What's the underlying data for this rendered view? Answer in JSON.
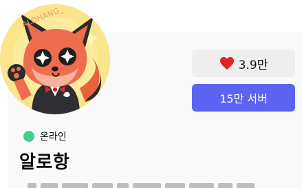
{
  "profile": {
    "avatar_watermark": "ALOHANG_",
    "status_text": "온라인",
    "name": "알로항"
  },
  "actions": {
    "like_count": "3.9만",
    "server_label": "15만 서버"
  },
  "colors": {
    "accent_button": "#5c63f2",
    "like_heart": "#e02424",
    "online_dot": "#3ecf8e"
  },
  "icons": {
    "like": "heart-icon",
    "status": "status-dot"
  }
}
